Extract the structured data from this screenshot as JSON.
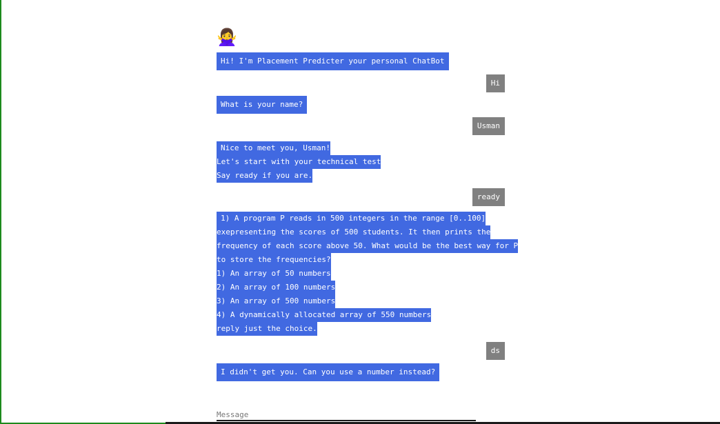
{
  "bot_avatar": "🙅‍♀️",
  "messages": [
    {
      "from": "bot",
      "lines": [
        "Hi! I'm Placement Predicter your personal ChatBot"
      ]
    },
    {
      "from": "user",
      "text": "Hi"
    },
    {
      "from": "bot",
      "lines": [
        "What is your name?"
      ]
    },
    {
      "from": "user",
      "text": "Usman"
    },
    {
      "from": "bot",
      "lines": [
        "Nice to meet you, Usman!",
        "Let's start with your technical test",
        "Say ready if you are."
      ]
    },
    {
      "from": "user",
      "text": "ready"
    },
    {
      "from": "bot",
      "lines": [
        "1) A program P reads in 500 integers in the range [0..100]",
        "exepresenting the scores of 500 students. It then prints the",
        "frequency of each score above 50. What would be the best way for P",
        "to store the frequencies?",
        "1) An array of 50 numbers",
        "2) An array of 100 numbers",
        "3) An array of 500 numbers",
        "4) A dynamically allocated array of 550 numbers",
        "reply just the choice."
      ]
    },
    {
      "from": "user",
      "text": "ds"
    },
    {
      "from": "bot",
      "lines": [
        "I didn't get you. Can you use a number instead?"
      ]
    }
  ],
  "composer": {
    "placeholder": "Message"
  },
  "colors": {
    "bot_bubble": "#4169e1",
    "user_bubble": "#808080",
    "frame": "#1d8a1d"
  }
}
